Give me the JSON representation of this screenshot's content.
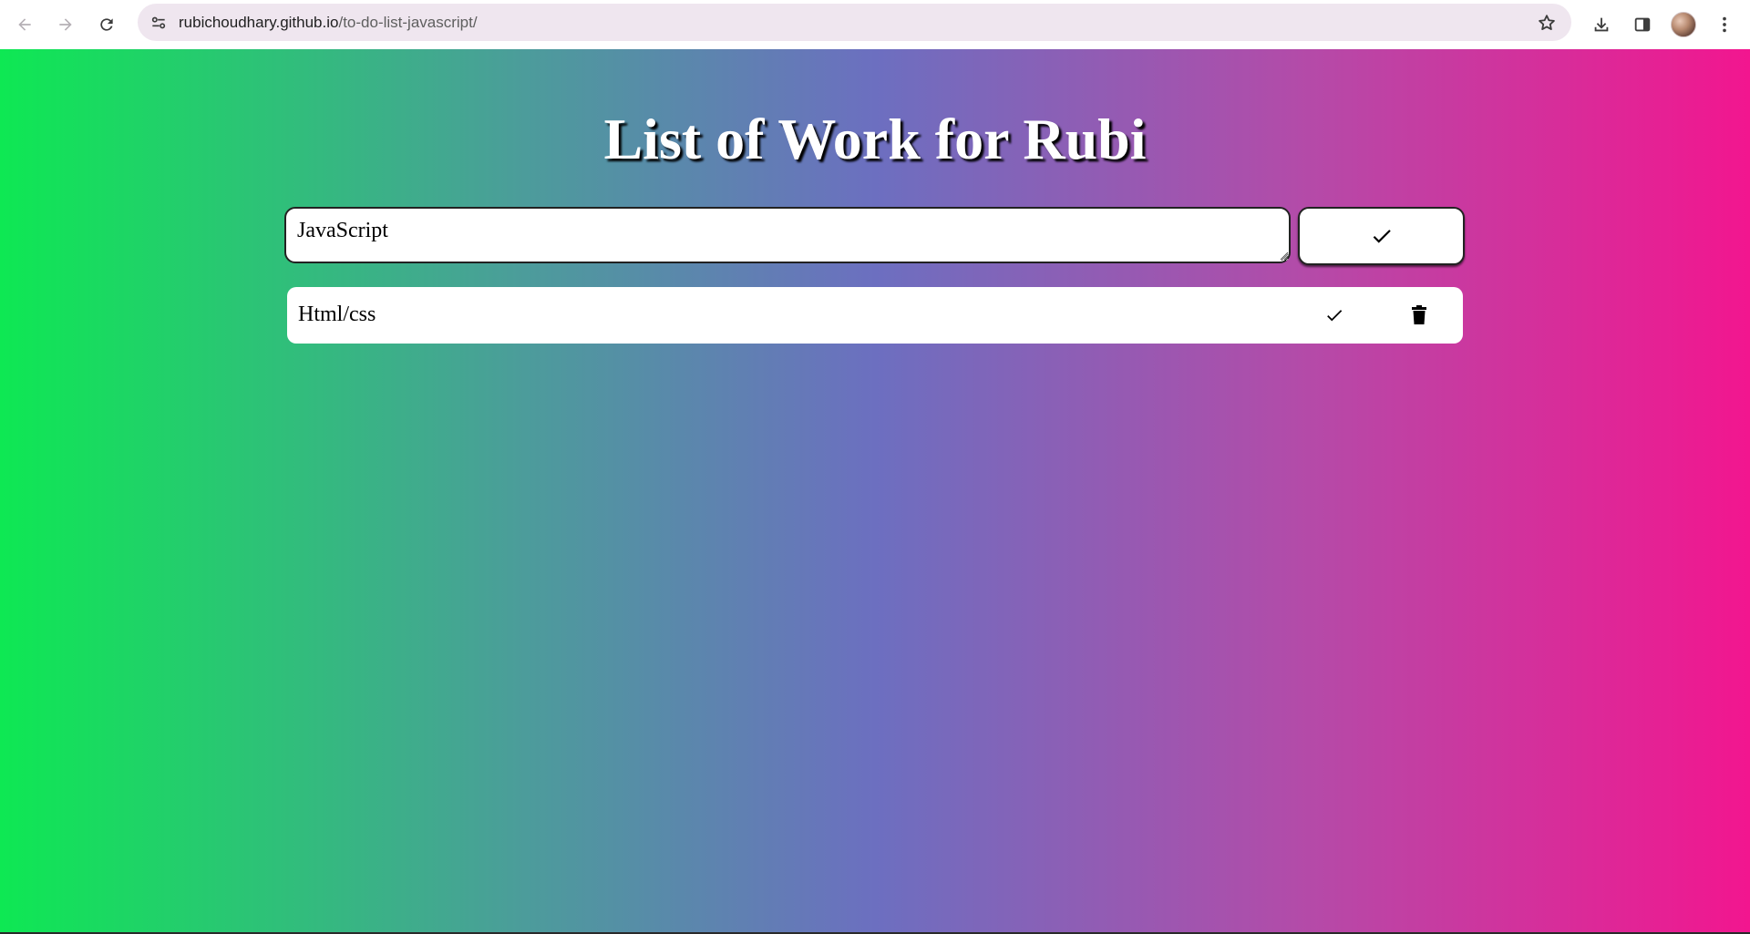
{
  "browser": {
    "url_host": "rubichoudhary.github.io",
    "url_path": "/to-do-list-javascript/",
    "icons": {
      "back": "arrow-left-icon",
      "forward": "arrow-right-icon",
      "reload": "reload-icon",
      "site_info": "tune-icon",
      "bookmark": "star-icon",
      "downloads": "download-icon",
      "side_panel": "side-panel-icon",
      "profile": "avatar",
      "menu": "kebab-menu-icon"
    }
  },
  "app": {
    "title": "List of Work for Rubi",
    "input": {
      "value": "JavaScript"
    },
    "add_button_icon": "check-icon",
    "tasks": [
      {
        "text": "Html/css",
        "done_icon": "check-icon",
        "delete_icon": "trash-icon"
      }
    ]
  },
  "colors": {
    "gradient_start": "#0ee853",
    "gradient_mid": "#6c6fc0",
    "gradient_end": "#f2168f"
  }
}
